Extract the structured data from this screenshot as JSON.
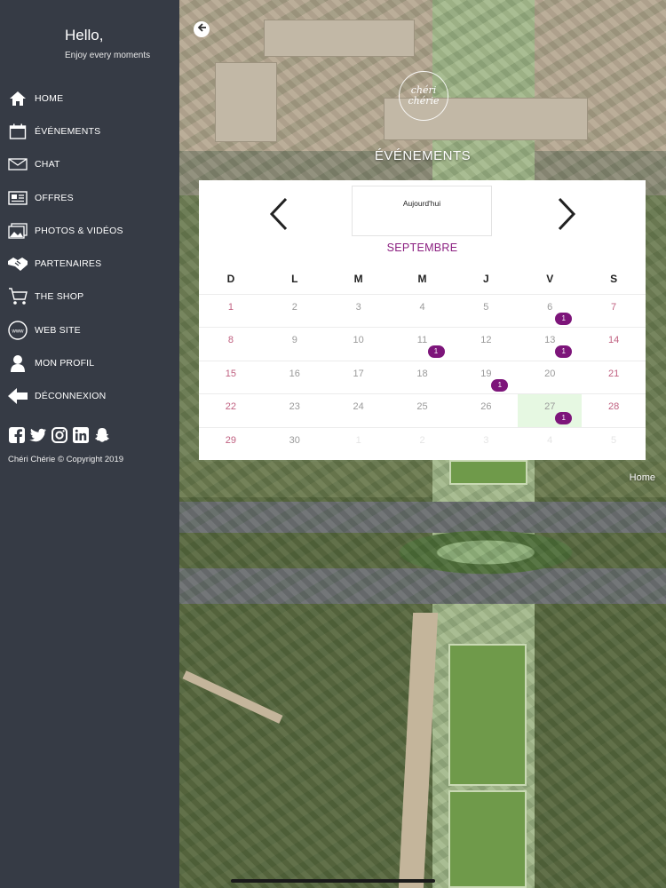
{
  "sidebar": {
    "greeting": "Hello,",
    "tagline": "Enjoy every moments",
    "items": [
      {
        "label": "HOME",
        "icon": "home-icon"
      },
      {
        "label": "ÉVÉNEMENTS",
        "icon": "calendar-icon"
      },
      {
        "label": "CHAT",
        "icon": "envelope-icon"
      },
      {
        "label": "OFFRES",
        "icon": "newspaper-icon"
      },
      {
        "label": "PHOTOS & VIDÉOS",
        "icon": "photos-icon"
      },
      {
        "label": "PARTENAIRES",
        "icon": "handshake-icon"
      },
      {
        "label": "THE SHOP",
        "icon": "cart-icon"
      },
      {
        "label": "WEB SITE",
        "icon": "www-icon"
      },
      {
        "label": "MON PROFIL",
        "icon": "user-icon"
      },
      {
        "label": "DÉCONNEXION",
        "icon": "logout-arrow-icon"
      }
    ],
    "social": [
      "facebook-icon",
      "twitter-icon",
      "instagram-icon",
      "linkedin-icon",
      "snapchat-icon"
    ],
    "copyright": "Chéri Chérie © Copyright 2019"
  },
  "main": {
    "title": "ÉVÉNEMENTS",
    "logo_text": "chéri chérie",
    "home_link": "Home"
  },
  "calendar": {
    "today_label": "Aujourd'hui",
    "month": "SEPTEMBRE",
    "weekdays": [
      "D",
      "L",
      "M",
      "M",
      "J",
      "V",
      "S"
    ],
    "weeks": [
      [
        {
          "d": "1"
        },
        {
          "d": "2"
        },
        {
          "d": "3"
        },
        {
          "d": "4"
        },
        {
          "d": "5"
        },
        {
          "d": "6",
          "badge": "1"
        },
        {
          "d": "7"
        }
      ],
      [
        {
          "d": "8"
        },
        {
          "d": "9"
        },
        {
          "d": "10"
        },
        {
          "d": "11",
          "badge": "1"
        },
        {
          "d": "12"
        },
        {
          "d": "13",
          "badge": "1"
        },
        {
          "d": "14"
        }
      ],
      [
        {
          "d": "15"
        },
        {
          "d": "16"
        },
        {
          "d": "17"
        },
        {
          "d": "18"
        },
        {
          "d": "19",
          "badge": "1"
        },
        {
          "d": "20"
        },
        {
          "d": "21"
        }
      ],
      [
        {
          "d": "22"
        },
        {
          "d": "23"
        },
        {
          "d": "24"
        },
        {
          "d": "25"
        },
        {
          "d": "26"
        },
        {
          "d": "27",
          "badge": "1",
          "selected": true
        },
        {
          "d": "28"
        }
      ],
      [
        {
          "d": "29"
        },
        {
          "d": "30"
        },
        {
          "d": "1",
          "muted": true
        },
        {
          "d": "2",
          "muted": true
        },
        {
          "d": "3",
          "muted": true
        },
        {
          "d": "4",
          "muted": true
        },
        {
          "d": "5",
          "muted": true
        }
      ]
    ],
    "colors": {
      "accent": "#8b1f80",
      "badge": "#7d157a",
      "selected": "#e6f8e2",
      "weekend": "#c06080"
    }
  }
}
